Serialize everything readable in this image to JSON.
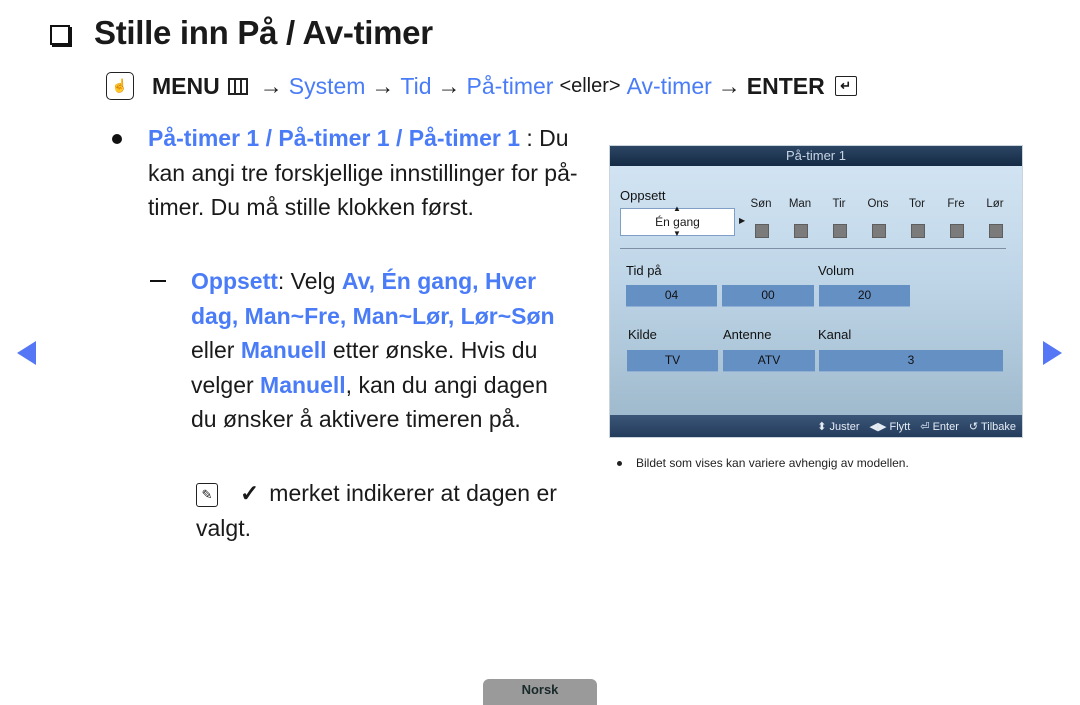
{
  "title": "Stille inn På / Av-timer",
  "path": {
    "menu": "MENU",
    "system": "System",
    "tid": "Tid",
    "pa_timer": "På-timer",
    "eller": "<eller>",
    "av_timer": "Av-timer",
    "enter": "ENTER",
    "arrow": "→"
  },
  "bullet1": {
    "highlight": "På-timer 1 / På-timer 1 / På-timer 1",
    "text": " : Du kan angi tre forskjellige innstillinger for på-timer. Du må stille klokken først."
  },
  "bullet2": {
    "oppsett": "Oppsett",
    "velg": ": Velg ",
    "options1": "Av, Én gang, Hver dag, Man~Fre, Man~Lør, Lør~Søn",
    "eller": " eller ",
    "manuell": "Manuell",
    "etter": " etter ønske. Hvis du velger ",
    "manuell2": "Manuell",
    "rest": ", kan du angi dagen du ønsker å aktivere timeren på."
  },
  "note": {
    "check": "✓",
    "text": "merket indikerer at dagen er valgt."
  },
  "panel": {
    "title": "På-timer 1",
    "oppsett_label": "Oppsett",
    "oppsett_value": "Én gang",
    "days": [
      "Søn",
      "Man",
      "Tir",
      "Ons",
      "Tor",
      "Fre",
      "Lør"
    ],
    "tid_label": "Tid på",
    "hour": "04",
    "minute": "00",
    "volum_label": "Volum",
    "volum": "20",
    "kilde_label": "Kilde",
    "kilde": "TV",
    "antenne_label": "Antenne",
    "antenne": "ATV",
    "kanal_label": "Kanal",
    "kanal": "3",
    "footer": {
      "juster": "Juster",
      "flytt": "Flytt",
      "enter": "Enter",
      "tilbake": "Tilbake"
    }
  },
  "footnote": "Bildet som vises kan variere avhengig av modellen.",
  "language_tab": "Norsk"
}
